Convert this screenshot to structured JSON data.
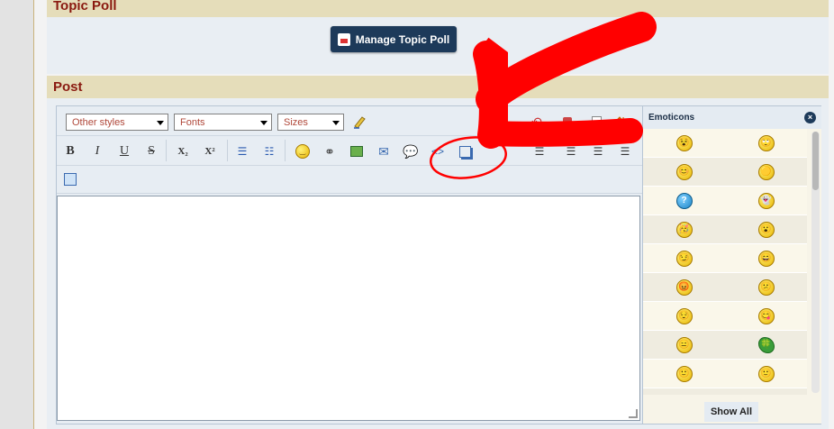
{
  "poll": {
    "title": "Topic Poll",
    "manage_button": "Manage Topic Poll"
  },
  "post": {
    "title": "Post"
  },
  "toolbar": {
    "styles_select": "Other styles",
    "fonts_select": "Fonts",
    "sizes_select": "Sizes",
    "bold": "B",
    "italic": "I",
    "underline": "U",
    "strike": "S",
    "subscript": "X₂",
    "superscript": "X²"
  },
  "emoticons": {
    "title": "Emoticons",
    "close": "×",
    "show_all": "Show All",
    "items": [
      [
        "😵",
        "🙄"
      ],
      [
        "😊",
        "🟡"
      ],
      [
        "?",
        "👻"
      ],
      [
        "🥳",
        "😮"
      ],
      [
        "😏",
        "😄"
      ],
      [
        "😡",
        "😕"
      ],
      [
        "😌",
        "😋"
      ],
      [
        "😑",
        "🍀"
      ],
      [
        "🙂",
        "🙂"
      ],
      [
        "😵",
        "😤"
      ]
    ]
  },
  "colors": {
    "accent": "#1d3a5a",
    "header_text": "#8a1a10",
    "annotation": "#ff0000"
  }
}
